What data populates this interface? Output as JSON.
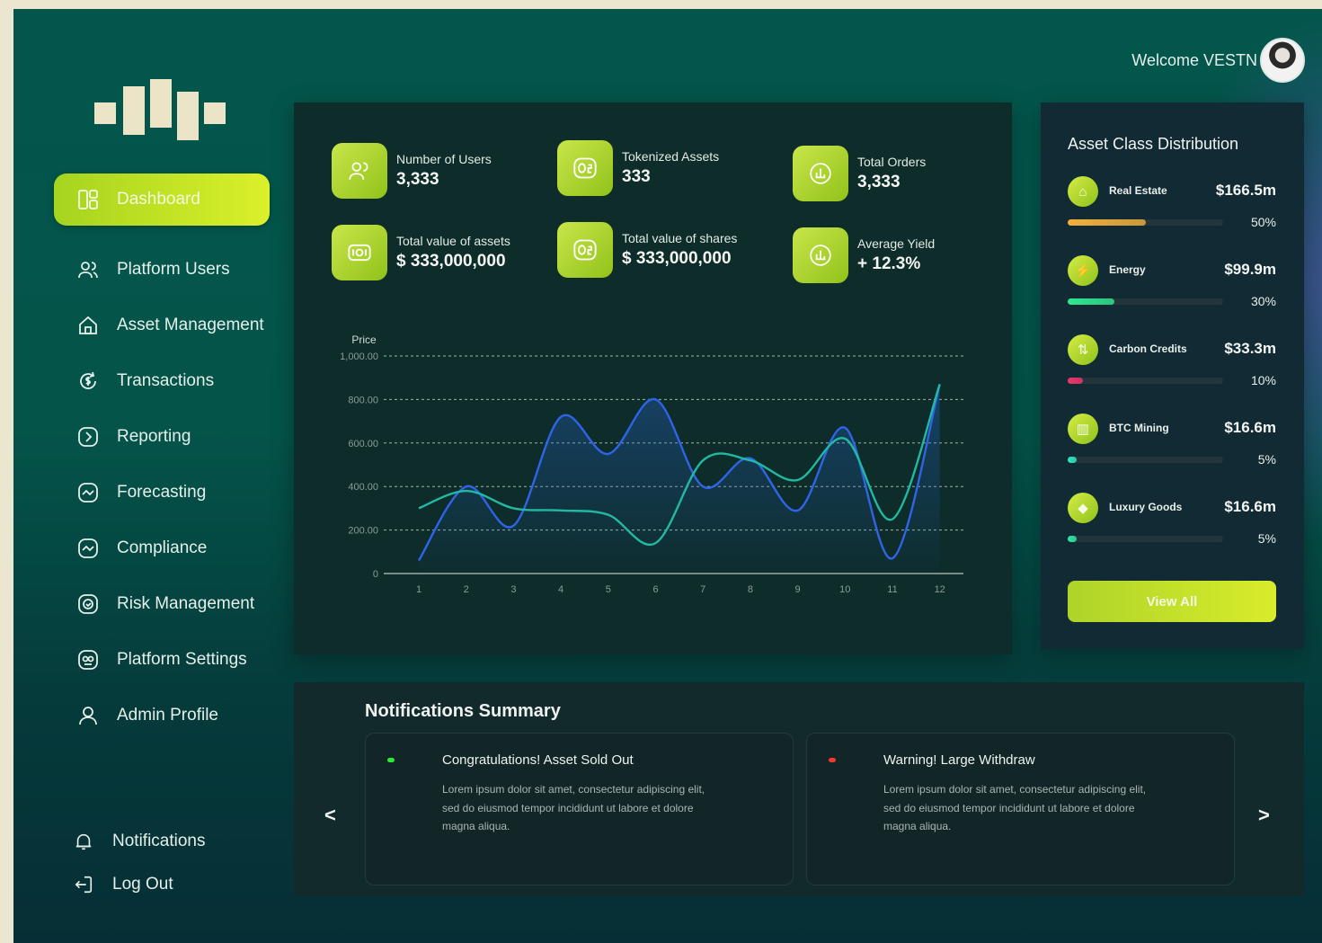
{
  "header": {
    "welcome": "Welcome VESTN"
  },
  "sidebar": {
    "items": [
      {
        "label": "Dashboard"
      },
      {
        "label": "Platform Users"
      },
      {
        "label": "Asset Management"
      },
      {
        "label": "Transactions"
      },
      {
        "label": "Reporting"
      },
      {
        "label": "Forecasting"
      },
      {
        "label": "Compliance"
      },
      {
        "label": "Risk Management"
      },
      {
        "label": "Platform Settings"
      },
      {
        "label": "Admin Profile"
      }
    ],
    "bottom": [
      {
        "label": "Notifications"
      },
      {
        "label": "Log Out"
      }
    ]
  },
  "stats": [
    {
      "label": "Number of Users",
      "value": "3,333"
    },
    {
      "label": "Tokenized Assets",
      "value": "333"
    },
    {
      "label": "Total Orders",
      "value": "3,333"
    },
    {
      "label": "Total value of assets",
      "value": "$ 333,000,000"
    },
    {
      "label": "Total value of shares",
      "value": "$ 333,000,000"
    },
    {
      "label": "Average Yield",
      "value": "+ 12.3%"
    }
  ],
  "chart_data": {
    "type": "line",
    "ylabel": "Price",
    "ylim": [
      0,
      1000
    ],
    "y_ticks": [
      "0",
      "200.00",
      "400.00",
      "600.00",
      "800.00",
      "1,000.00"
    ],
    "x": [
      1,
      2,
      3,
      4,
      5,
      6,
      7,
      8,
      9,
      10,
      11,
      12
    ],
    "grid": true,
    "series": [
      {
        "values": [
          60,
          400,
          220,
          720,
          550,
          800,
          400,
          530,
          290,
          670,
          70,
          870
        ],
        "color": "#2f64e8"
      },
      {
        "values": [
          300,
          380,
          300,
          290,
          270,
          140,
          520,
          520,
          430,
          620,
          250,
          870
        ],
        "color": "#22b8a2"
      }
    ]
  },
  "assets": {
    "title": "Asset Class Distribution",
    "items": [
      {
        "name": "Real Estate",
        "value": "$166.5m",
        "percent": "50%",
        "fraction": 0.5,
        "color": "#f2b03a",
        "icon": "home-icon"
      },
      {
        "name": "Energy",
        "value": "$99.9m",
        "percent": "30%",
        "fraction": 0.3,
        "color": "#2ee88e",
        "icon": "lightning-icon"
      },
      {
        "name": "Carbon Credits",
        "value": "$33.3m",
        "percent": "10%",
        "fraction": 0.1,
        "color": "#f0356a",
        "icon": "swap-icon"
      },
      {
        "name": "BTC Mining",
        "value": "$16.6m",
        "percent": "5%",
        "fraction": 0.05,
        "color": "#2ee8c2",
        "icon": "chart-icon"
      },
      {
        "name": "Luxury Goods",
        "value": "$16.6m",
        "percent": "5%",
        "fraction": 0.05,
        "color": "#2ee8a8",
        "icon": "diamond-icon"
      }
    ],
    "view_all": "View All"
  },
  "notifications": {
    "title": "Notifications Summary",
    "cards": [
      {
        "title": "Congratulations! Asset Sold Out",
        "body": "Lorem ipsum dolor sit amet, consectetur adipiscing elit, sed do eiusmod tempor incididunt ut labore et dolore magna aliqua.",
        "dot_color": "#2ee83a"
      },
      {
        "title": "Warning! Large Withdraw",
        "body": "Lorem ipsum dolor sit amet, consectetur adipiscing elit, sed do eiusmod tempor incididunt ut labore et dolore magna aliqua.",
        "dot_color": "#f03a2a"
      }
    ],
    "prev": "<",
    "next": ">"
  }
}
